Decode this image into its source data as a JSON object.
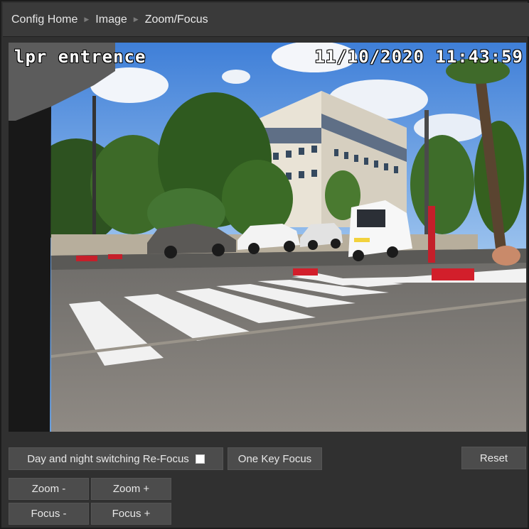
{
  "breadcrumb": {
    "items": [
      "Config Home",
      "Image",
      "Zoom/Focus"
    ]
  },
  "video": {
    "osd_title": "lpr entrence",
    "osd_timestamp": "11/10/2020  11:43:59"
  },
  "controls": {
    "refocus_label": "Day and night switching Re-Focus",
    "refocus_checked": false,
    "one_key_focus_label": "One Key Focus",
    "reset_label": "Reset",
    "zoom_minus_label": "Zoom -",
    "zoom_plus_label": "Zoom +",
    "focus_minus_label": "Focus -",
    "focus_plus_label": "Focus +"
  },
  "icons": {
    "breadcrumb_separator": "triangle-right-icon",
    "checkbox": "checkbox-icon"
  },
  "colors": {
    "panel_bg": "#303030",
    "header_bg": "#3a3a3a",
    "button_bg": "#4c4c4c",
    "text": "#e8e8e8"
  }
}
